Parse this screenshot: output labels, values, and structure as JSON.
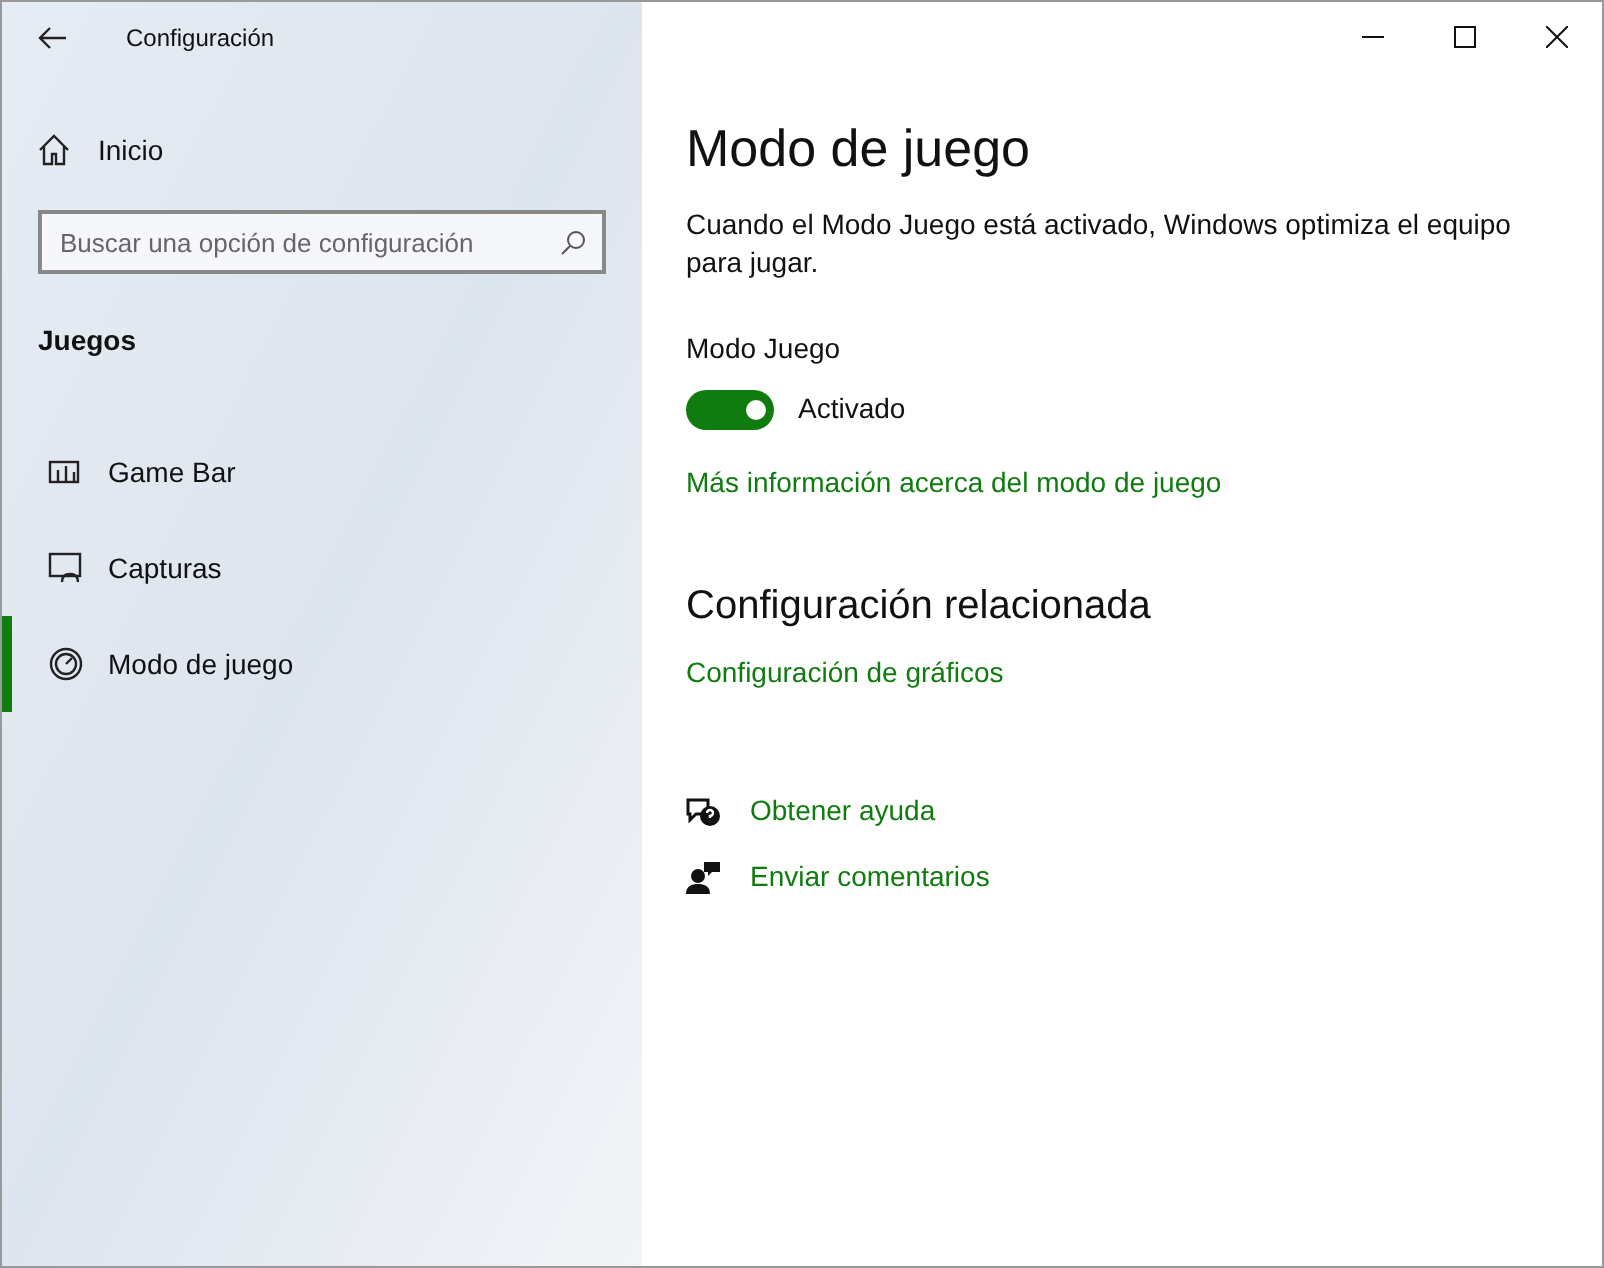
{
  "window": {
    "title": "Configuración"
  },
  "sidebar": {
    "home": "Inicio",
    "search": {
      "placeholder": "Buscar una opción de configuración"
    },
    "section": "Juegos",
    "items": [
      {
        "label": "Game Bar",
        "kind": "gamebar",
        "selected": false
      },
      {
        "label": "Capturas",
        "kind": "captures",
        "selected": false
      },
      {
        "label": "Modo de juego",
        "kind": "gamemode",
        "selected": true
      }
    ]
  },
  "page": {
    "title": "Modo de juego",
    "description": "Cuando el Modo Juego está activado, Windows optimiza el equipo para jugar.",
    "toggle": {
      "label": "Modo Juego",
      "on": true,
      "state_text": "Activado"
    },
    "more_info_link": "Más información acerca del modo de juego",
    "related_heading": "Configuración relacionada",
    "related_link": "Configuración de gráficos",
    "help_links": [
      {
        "label": "Obtener ayuda",
        "kind": "help"
      },
      {
        "label": "Enviar comentarios",
        "kind": "feedback"
      }
    ]
  }
}
